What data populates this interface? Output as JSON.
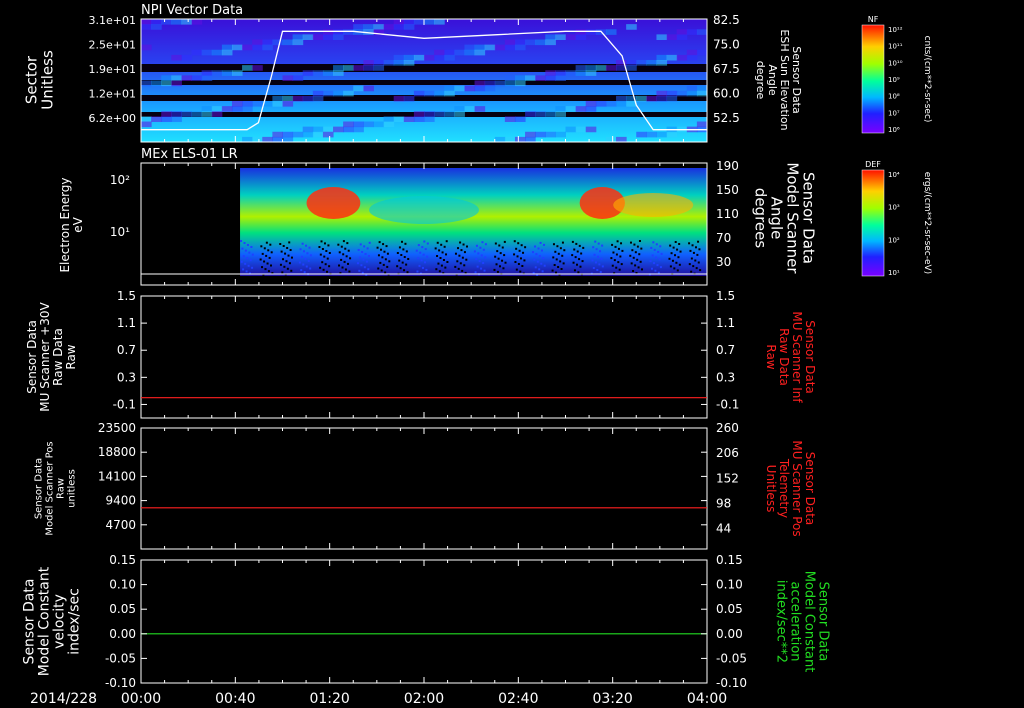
{
  "date_label": "2014/228",
  "time_ticks": [
    "00:00",
    "00:40",
    "01:20",
    "02:00",
    "02:40",
    "03:20",
    "04:00"
  ],
  "colorbars": [
    {
      "title": "NF",
      "units": "cnts/(cm**2-sr-sec)",
      "ticks": [
        "10¹²",
        "10¹¹",
        "10¹⁰",
        "10⁹",
        "10⁸",
        "10⁷",
        "10⁶"
      ]
    },
    {
      "title": "DEF",
      "units": "ergs/(cm**2-sr-sec-eV)",
      "ticks": [
        "10⁴",
        "10³",
        "10²",
        "10¹"
      ]
    }
  ],
  "colors": {
    "background": "#000000",
    "axes": "#ffffff",
    "red_trace": "#ff2020",
    "green_trace": "#22dd22"
  },
  "chart_data": [
    {
      "type": "heatmap",
      "title": "NPI Vector Data",
      "ylabel_left": [
        "Sector",
        "Unitless"
      ],
      "yticks_left": [
        "3.1e+01",
        "2.5e+01",
        "1.9e+01",
        "1.2e+01",
        "6.2e+00"
      ],
      "ylabel_right": [
        "Sensor Data",
        "ESH Sun Elevation",
        "Angle",
        "degree"
      ],
      "yticks_right": [
        "82.5",
        "75.0",
        "67.5",
        "60.0",
        "52.5"
      ],
      "yrange_right": [
        47.5,
        82.5
      ],
      "overlay_line": {
        "x_hours": [
          0.0,
          0.75,
          0.83,
          0.92,
          1.0,
          1.5,
          2.0,
          2.5,
          3.0,
          3.25,
          3.4,
          3.5,
          3.62,
          4.0
        ],
        "values": [
          51,
          51,
          53,
          66,
          79,
          79,
          77,
          78,
          79,
          79,
          72,
          58,
          51,
          51
        ]
      }
    },
    {
      "type": "heatmap",
      "title": "MEx ELS-01 LR",
      "ylabel_left": [
        "Electron Energy",
        "eV"
      ],
      "yticks_left": [
        "10²",
        "10¹"
      ],
      "ylabel_right": [
        "Sensor Data",
        "Model Scanner",
        "Angle",
        "degrees"
      ],
      "yticks_right": [
        "190",
        "150",
        "110",
        "70",
        "30"
      ],
      "overlay_line": {
        "x_hours": [
          0.0,
          4.0
        ],
        "values": [
          12,
          12
        ]
      }
    },
    {
      "type": "line",
      "ylabel_left": [
        "Sensor Data",
        "MU Scanner +30V",
        "Raw Data",
        "Raw"
      ],
      "yticks_left": [
        "1.5",
        "1.1",
        "0.7",
        "0.3",
        "-0.1"
      ],
      "ylim_left": [
        -0.3,
        1.5
      ],
      "ylabel_right": [
        "Sensor Data",
        "MU Scanner Inf",
        "Raw Data",
        "Raw"
      ],
      "yticks_right": [
        "1.5",
        "1.1",
        "0.7",
        "0.3",
        "-0.1"
      ],
      "series": [
        {
          "x_hours": [
            0.0,
            4.0
          ],
          "values": [
            0.0,
            0.0
          ]
        }
      ]
    },
    {
      "type": "line",
      "ylabel_left": [
        "Sensor Data",
        "Model Scanner Pos",
        "Raw",
        "unitless"
      ],
      "yticks_left": [
        "23500",
        "18800",
        "14100",
        "9400",
        "4700"
      ],
      "ylim_left": [
        0,
        23500
      ],
      "ylabel_right": [
        "Sensor Data",
        "MU Scanner Pos",
        "Telemetry",
        "Unitless"
      ],
      "yticks_right": [
        "260",
        "206",
        "152",
        "98",
        "44"
      ],
      "series": [
        {
          "x_hours": [
            0.0,
            4.0
          ],
          "values": [
            8000,
            8000
          ]
        }
      ]
    },
    {
      "type": "line",
      "ylabel_left": [
        "Sensor Data",
        "Model Constant",
        "velocity",
        "index/sec"
      ],
      "yticks_left": [
        "0.15",
        "0.10",
        "0.05",
        "0.00",
        "-0.05",
        "-0.10"
      ],
      "ylim_left": [
        -0.1,
        0.15
      ],
      "ylabel_right": [
        "Sensor Data",
        "Model Constant",
        "acceleration",
        "index/sec**2"
      ],
      "yticks_right": [
        "0.15",
        "0.10",
        "0.05",
        "0.00",
        "-0.05",
        "-0.10"
      ],
      "series": [
        {
          "x_hours": [
            0.0,
            4.0
          ],
          "values": [
            0.0,
            0.0
          ]
        }
      ]
    }
  ]
}
